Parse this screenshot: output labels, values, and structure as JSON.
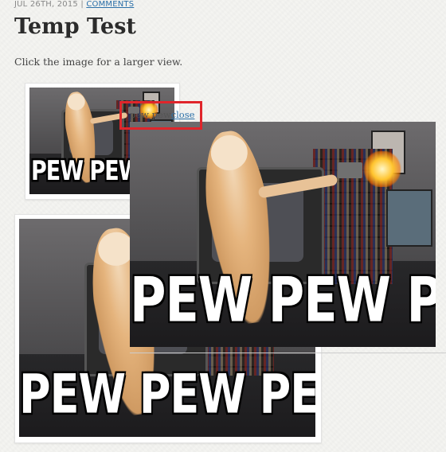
{
  "post": {
    "date": "JUL 26TH, 2015 |",
    "comments_link": "COMMENTS",
    "title": "Temp Test",
    "intro": "Click the image for a larger view."
  },
  "image": {
    "caption": "PEW PEW PEW"
  },
  "lightbox": {
    "caption_text": "pew pew",
    "close_label": "close"
  },
  "colors": {
    "link": "#2a6fa8",
    "highlight": "#e0252b"
  }
}
